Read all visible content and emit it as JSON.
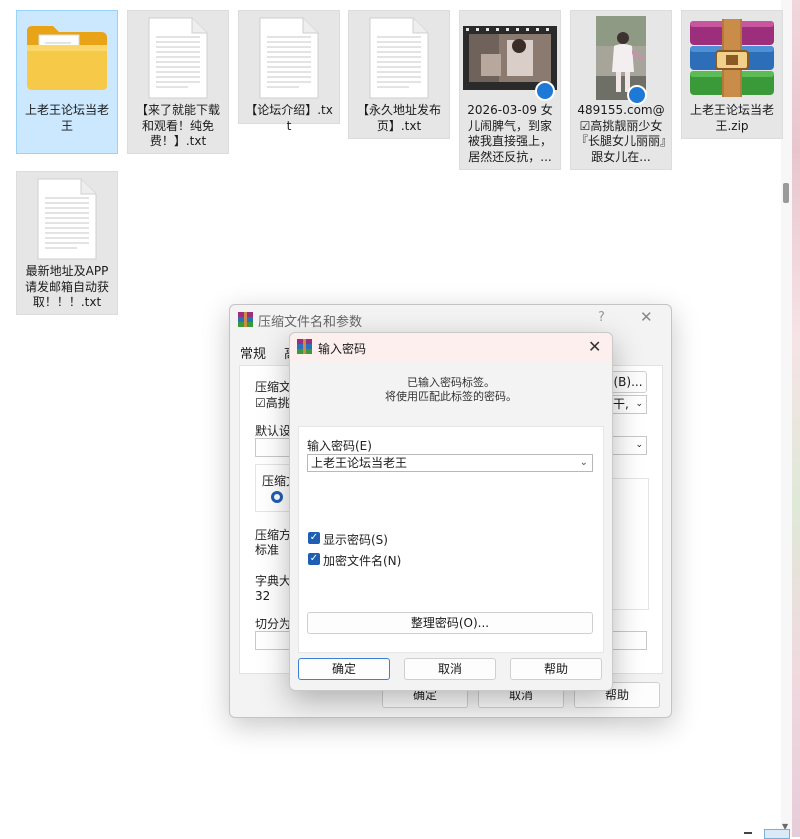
{
  "files": [
    {
      "name": "上老王论坛当老王",
      "type": "folder",
      "selected": true
    },
    {
      "name": "【来了就能下载和观看！纯免费！】.txt",
      "type": "text"
    },
    {
      "name": "【论坛介绍】.txt",
      "type": "text"
    },
    {
      "name": "【永久地址发布页】.txt",
      "type": "text"
    },
    {
      "name": "2026-03-09 女儿闹脾气，到家被我直接强上，居然还反抗，...",
      "type": "video"
    },
    {
      "name": "489155.com@☑高挑靓丽少女『长腿女儿丽丽』跟女儿在...",
      "type": "video-portrait"
    },
    {
      "name": "上老王论坛当老王.zip",
      "type": "zip"
    },
    {
      "name": "最新地址及APP请发邮箱自动获取！！！.txt",
      "type": "text"
    }
  ],
  "compress_dialog": {
    "title": "压缩文件名和参数",
    "help_glyph": "?",
    "close_glyph": "✕",
    "tabs": [
      "常规",
      "高"
    ],
    "label_archive_name": "压缩文件",
    "archive_name_value": "☑高挑",
    "label_default": "默认设置",
    "label_archive_format": "压缩文",
    "label_method": "压缩方式",
    "method_value": "标准",
    "label_dict": "字典大小",
    "dict_value": "32",
    "label_split": "切分为分卷",
    "browse_label": "(B)...",
    "update_value": "干,",
    "ok": "确定",
    "cancel": "取消",
    "help": "帮助"
  },
  "password_dialog": {
    "title": "输入密码",
    "close_glyph": "✕",
    "message_line1": "已输入密码标签。",
    "message_line2": "将使用匹配此标签的密码。",
    "label_password": "输入密码(E)",
    "password_value": "上老王论坛当老王",
    "show_password": "显示密码(S)",
    "encrypt_names": "加密文件名(N)",
    "show_password_checked": true,
    "encrypt_names_checked": true,
    "organize_button": "整理密码(O)...",
    "ok": "确定",
    "cancel": "取消",
    "help": "帮助"
  }
}
